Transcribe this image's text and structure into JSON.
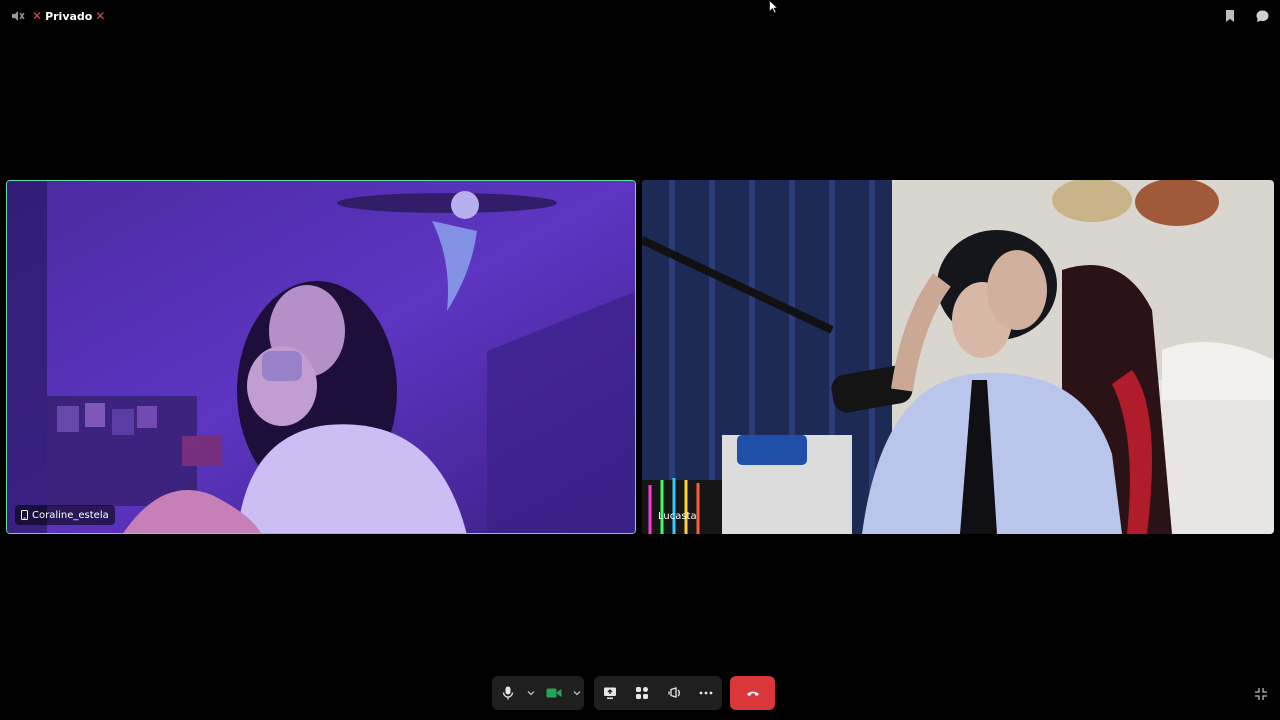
{
  "header": {
    "channel_name": "Privado",
    "icons": [
      "speaker-muted-icon",
      "x-icon",
      "bookmark-icon",
      "chat-bubble-icon"
    ]
  },
  "participants": [
    {
      "name": "Coraline_estela",
      "device_icon": "mobile-phone-icon",
      "speaking": true
    },
    {
      "name": "Lucasta",
      "device_icon": null,
      "speaking": false
    }
  ],
  "controls": {
    "buttons": [
      "microphone-icon",
      "chevron-down-icon",
      "camera-icon",
      "chevron-down-icon",
      "screen-share-icon",
      "activities-icon",
      "soundboard-icon",
      "more-icon",
      "hang-up-icon",
      "collapse-icon"
    ]
  },
  "colors": {
    "background": "#000000",
    "speaking_border": "#5be0a6",
    "hangup": "#da373c",
    "camera_on": "#23a55a",
    "x_red": "#e5484d"
  }
}
